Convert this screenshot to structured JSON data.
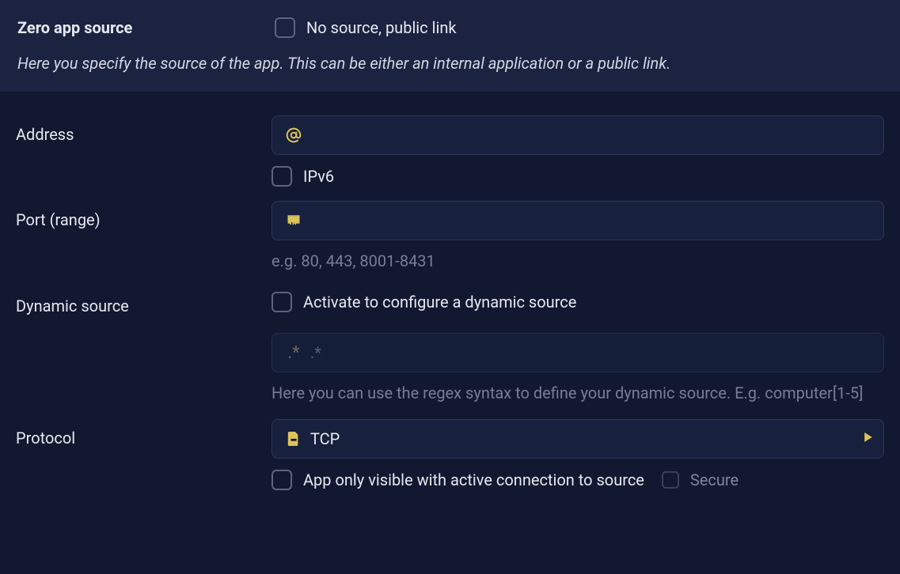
{
  "header": {
    "title": "Zero app source",
    "no_source_label": "No source, public link",
    "description": "Here you specify the source of the app. This can be either an internal application or a public link."
  },
  "address": {
    "label": "Address",
    "value": "",
    "ipv6_label": "IPv6"
  },
  "port": {
    "label": "Port (range)",
    "value": "",
    "hint": "e.g. 80, 443, 8001-8431"
  },
  "dynamic": {
    "label": "Dynamic source",
    "activate_label": "Activate to configure a dynamic source",
    "regex_value": "",
    "regex_placeholder": ".*",
    "hint": "Here you can use the regex syntax to define your dynamic source. E.g. computer[1-5]"
  },
  "protocol": {
    "label": "Protocol",
    "value": "TCP",
    "visible_label": "App only visible with active connection to source",
    "secure_label": "Secure"
  }
}
